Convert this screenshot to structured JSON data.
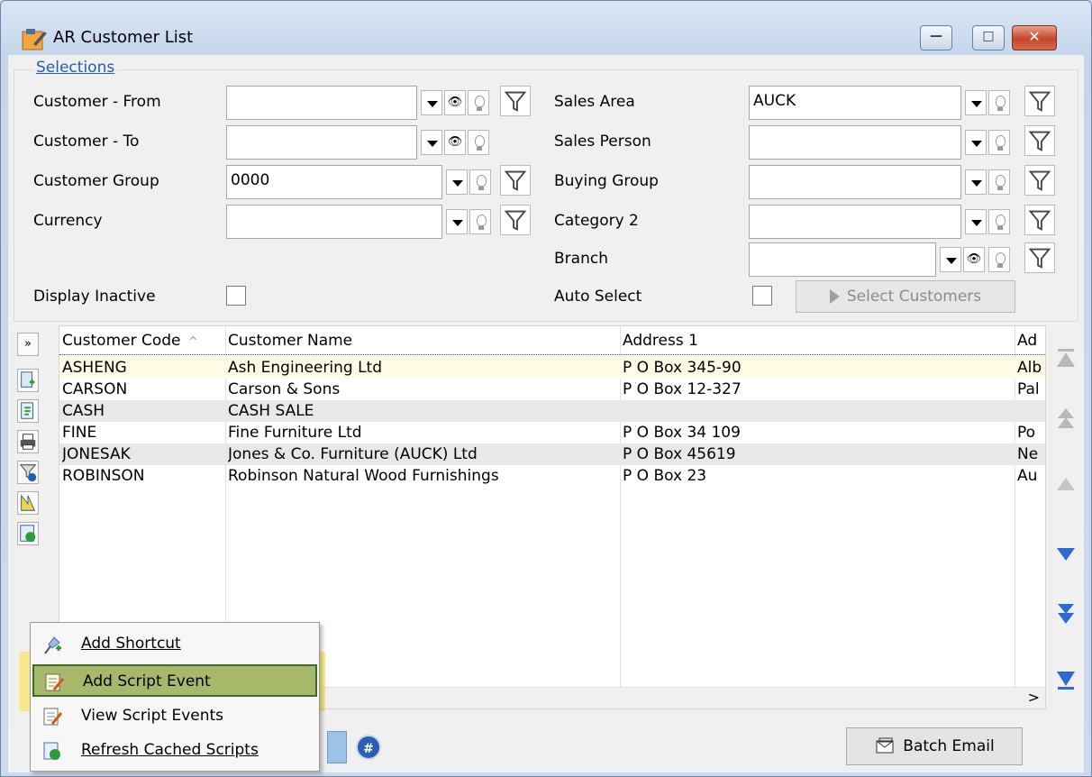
{
  "window": {
    "title": "AR Customer List",
    "minimize_glyph": "—",
    "maximize_glyph": "□",
    "close_glyph": "✕"
  },
  "selections": {
    "legend": "Selections",
    "customer_from": {
      "label": "Customer - From",
      "value": ""
    },
    "customer_to": {
      "label": "Customer - To",
      "value": ""
    },
    "customer_group": {
      "label": "Customer Group",
      "value": "0000"
    },
    "currency": {
      "label": "Currency",
      "value": ""
    },
    "sales_area": {
      "label": "Sales Area",
      "value": "AUCK"
    },
    "sales_person": {
      "label": "Sales Person",
      "value": ""
    },
    "buying_group": {
      "label": "Buying Group",
      "value": ""
    },
    "category_2": {
      "label": "Category 2",
      "value": ""
    },
    "branch": {
      "label": "Branch",
      "value": ""
    },
    "display_inactive": {
      "label": "Display Inactive",
      "checked": false
    },
    "auto_select": {
      "label": "Auto Select",
      "checked": false
    },
    "select_customers_button": "Select Customers"
  },
  "grid": {
    "columns": [
      "Customer Code",
      "Customer Name",
      "Address 1",
      "Ad"
    ],
    "sort_indicator": "^",
    "expand_glyph": "»",
    "rows": [
      {
        "code": "ASHENG",
        "name": "Ash Engineering Ltd",
        "address1": "P O Box 345-90",
        "address2": "Alb"
      },
      {
        "code": "CARSON",
        "name": "Carson & Sons",
        "address1": "P O Box 12-327",
        "address2": "Pal"
      },
      {
        "code": "CASH",
        "name": "CASH SALE",
        "address1": "",
        "address2": ""
      },
      {
        "code": "FINE",
        "name": "Fine Furniture Ltd",
        "address1": "P O Box 34 109",
        "address2": "Po"
      },
      {
        "code": "JONESAK",
        "name": "Jones & Co. Furniture (AUCK) Ltd",
        "address1": "P O Box 45619",
        "address2": "Ne"
      },
      {
        "code": "ROBINSON",
        "name": "Robinson Natural Wood Furnishings",
        "address1": "P O Box 23",
        "address2": "Au"
      }
    ],
    "scroll_right_glyph": ">"
  },
  "context_menu": {
    "items": [
      {
        "label": "Add Shortcut",
        "icon": "pin-add-icon"
      },
      {
        "label": "Add Script Event",
        "icon": "script-add-icon"
      },
      {
        "label": "View Script Events",
        "icon": "script-view-icon"
      },
      {
        "label": "Refresh Cached Scripts",
        "icon": "script-refresh-icon"
      }
    ]
  },
  "bottom": {
    "hash_glyph": "#",
    "batch_email_button": "Batch Email"
  },
  "colors": {
    "legend_blue": "#1f5fb3",
    "selected_row": "#fffbe5",
    "menu_highlight": "#a8b86a",
    "highlight_band": "#ffe23c",
    "nav_blue": "#2c6bd1"
  }
}
